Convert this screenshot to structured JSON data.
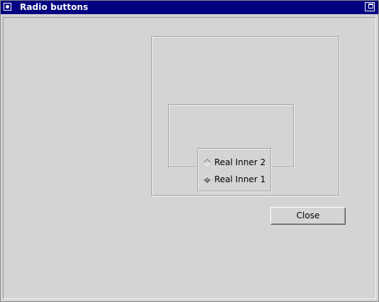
{
  "window": {
    "title": "Radio buttons"
  },
  "radios": [
    {
      "label": "Real Inner 2",
      "selected": false
    },
    {
      "label": "Real Inner 1",
      "selected": true
    }
  ],
  "buttons": {
    "close_label": "Close"
  },
  "colors": {
    "titlebar": "#000080",
    "background": "#d4d4d4"
  },
  "icons": {
    "window_menu": "window-menu-icon",
    "maximize": "maximize-icon",
    "radio": "diamond-radio-icon"
  }
}
